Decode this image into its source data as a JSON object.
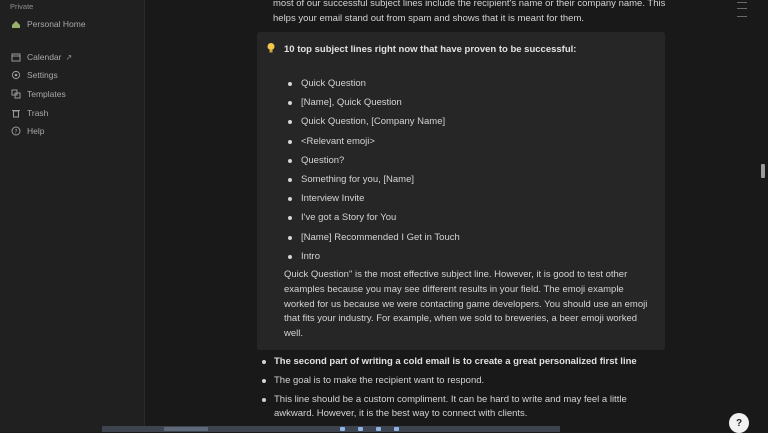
{
  "sidebar": {
    "section_label": "Private",
    "items": [
      {
        "label": "Personal Home",
        "icon": "home-icon"
      },
      {
        "label": "Calendar",
        "icon": "calendar-icon",
        "suffix": "↗"
      },
      {
        "label": "Settings",
        "icon": "gear-icon"
      },
      {
        "label": "Templates",
        "icon": "templates-icon"
      },
      {
        "label": "Trash",
        "icon": "trash-icon"
      },
      {
        "label": "Help",
        "icon": "help-icon"
      }
    ]
  },
  "main": {
    "intro_text": "most of our successful subject lines include the recipient's name or their company name. This helps your email stand out from spam and shows that it is meant for them.",
    "callout": {
      "icon": "lightbulb-icon",
      "title": "10 top subject lines right now that have proven to be successful:",
      "items": [
        "Quick Question",
        "[Name], Quick Question",
        "Quick Question, [Company Name]",
        "<Relevant emoji>",
        "Question?",
        "Something for you, [Name]",
        "Interview Invite",
        "I've got a Story for You",
        "[Name] Recommended I Get in Touch",
        "Intro"
      ],
      "paragraph": "Quick Question\" is the most effective subject line. However, it is good to test other examples because you may see different results in your field. The emoji example worked for us because we were contacting game developers. You should use an emoji that fits your industry. For example, when we sold to breweries, a beer emoji worked well."
    },
    "bullets": [
      "The second part of writing a cold email is to create a great personalized first line",
      "The goal is to make the recipient want to respond.",
      "This line should be a custom compliment. It can be hard to write and may feel a little awkward. However, it is the best way to connect with clients."
    ]
  },
  "help_button": {
    "label": "?"
  },
  "colors": {
    "background": "#191919",
    "sidebar": "#202020",
    "callout": "#262626",
    "text": "#d4d4d4"
  }
}
